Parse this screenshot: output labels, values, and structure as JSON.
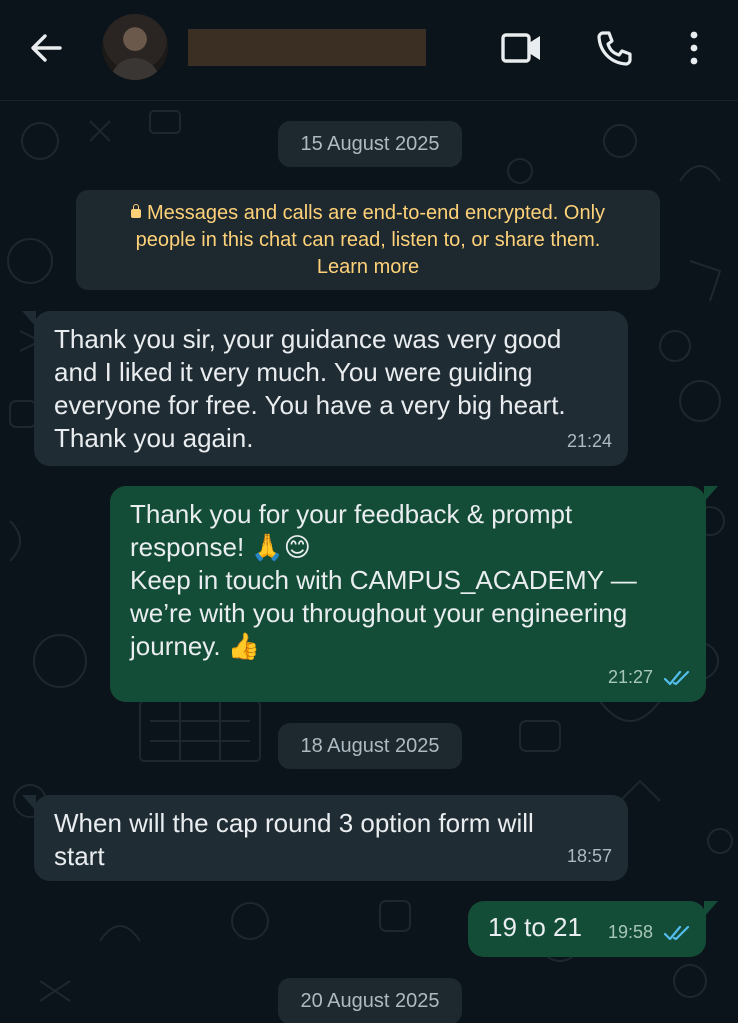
{
  "header": {
    "back_icon": "arrow-left-icon",
    "video_icon": "video-call-icon",
    "call_icon": "phone-icon",
    "menu_icon": "more-vertical-icon"
  },
  "chat": {
    "date_1": "15 August 2025",
    "encryption_line_1": "Messages and calls are end-to-end encrypted. Only",
    "encryption_line_2": "people in this chat can read, listen to, or share them.",
    "learn_more": "Learn more",
    "messages": [
      {
        "direction": "incoming",
        "lines": [
          "Thank you sir, your guidance was very good",
          "and I liked it very much. You were guiding",
          "everyone for free. You have a very big heart.",
          "Thank you again."
        ],
        "time": "21:24"
      },
      {
        "direction": "outgoing",
        "lines": [
          "Thank you for your feedback & prompt",
          "response! 🙏😊",
          "Keep in touch with CAMPUS_ACADEMY —",
          "we’re with you throughout your engineering",
          "journey. 👍"
        ],
        "time": "21:27",
        "status": "read"
      }
    ],
    "date_2": "18 August 2025",
    "messages_2": [
      {
        "direction": "incoming",
        "lines": [
          "When will the cap round 3 option form will",
          "start"
        ],
        "time": "18:57"
      },
      {
        "direction": "outgoing",
        "lines": [
          "19 to 21"
        ],
        "time": "19:58",
        "status": "read"
      }
    ],
    "date_3": "20 August 2025"
  },
  "colors": {
    "background": "#0b141a",
    "incoming_bubble": "#202c33",
    "outgoing_bubble": "#144d37",
    "encryption_text": "#ffd279",
    "read_ticks": "#53bdeb"
  }
}
